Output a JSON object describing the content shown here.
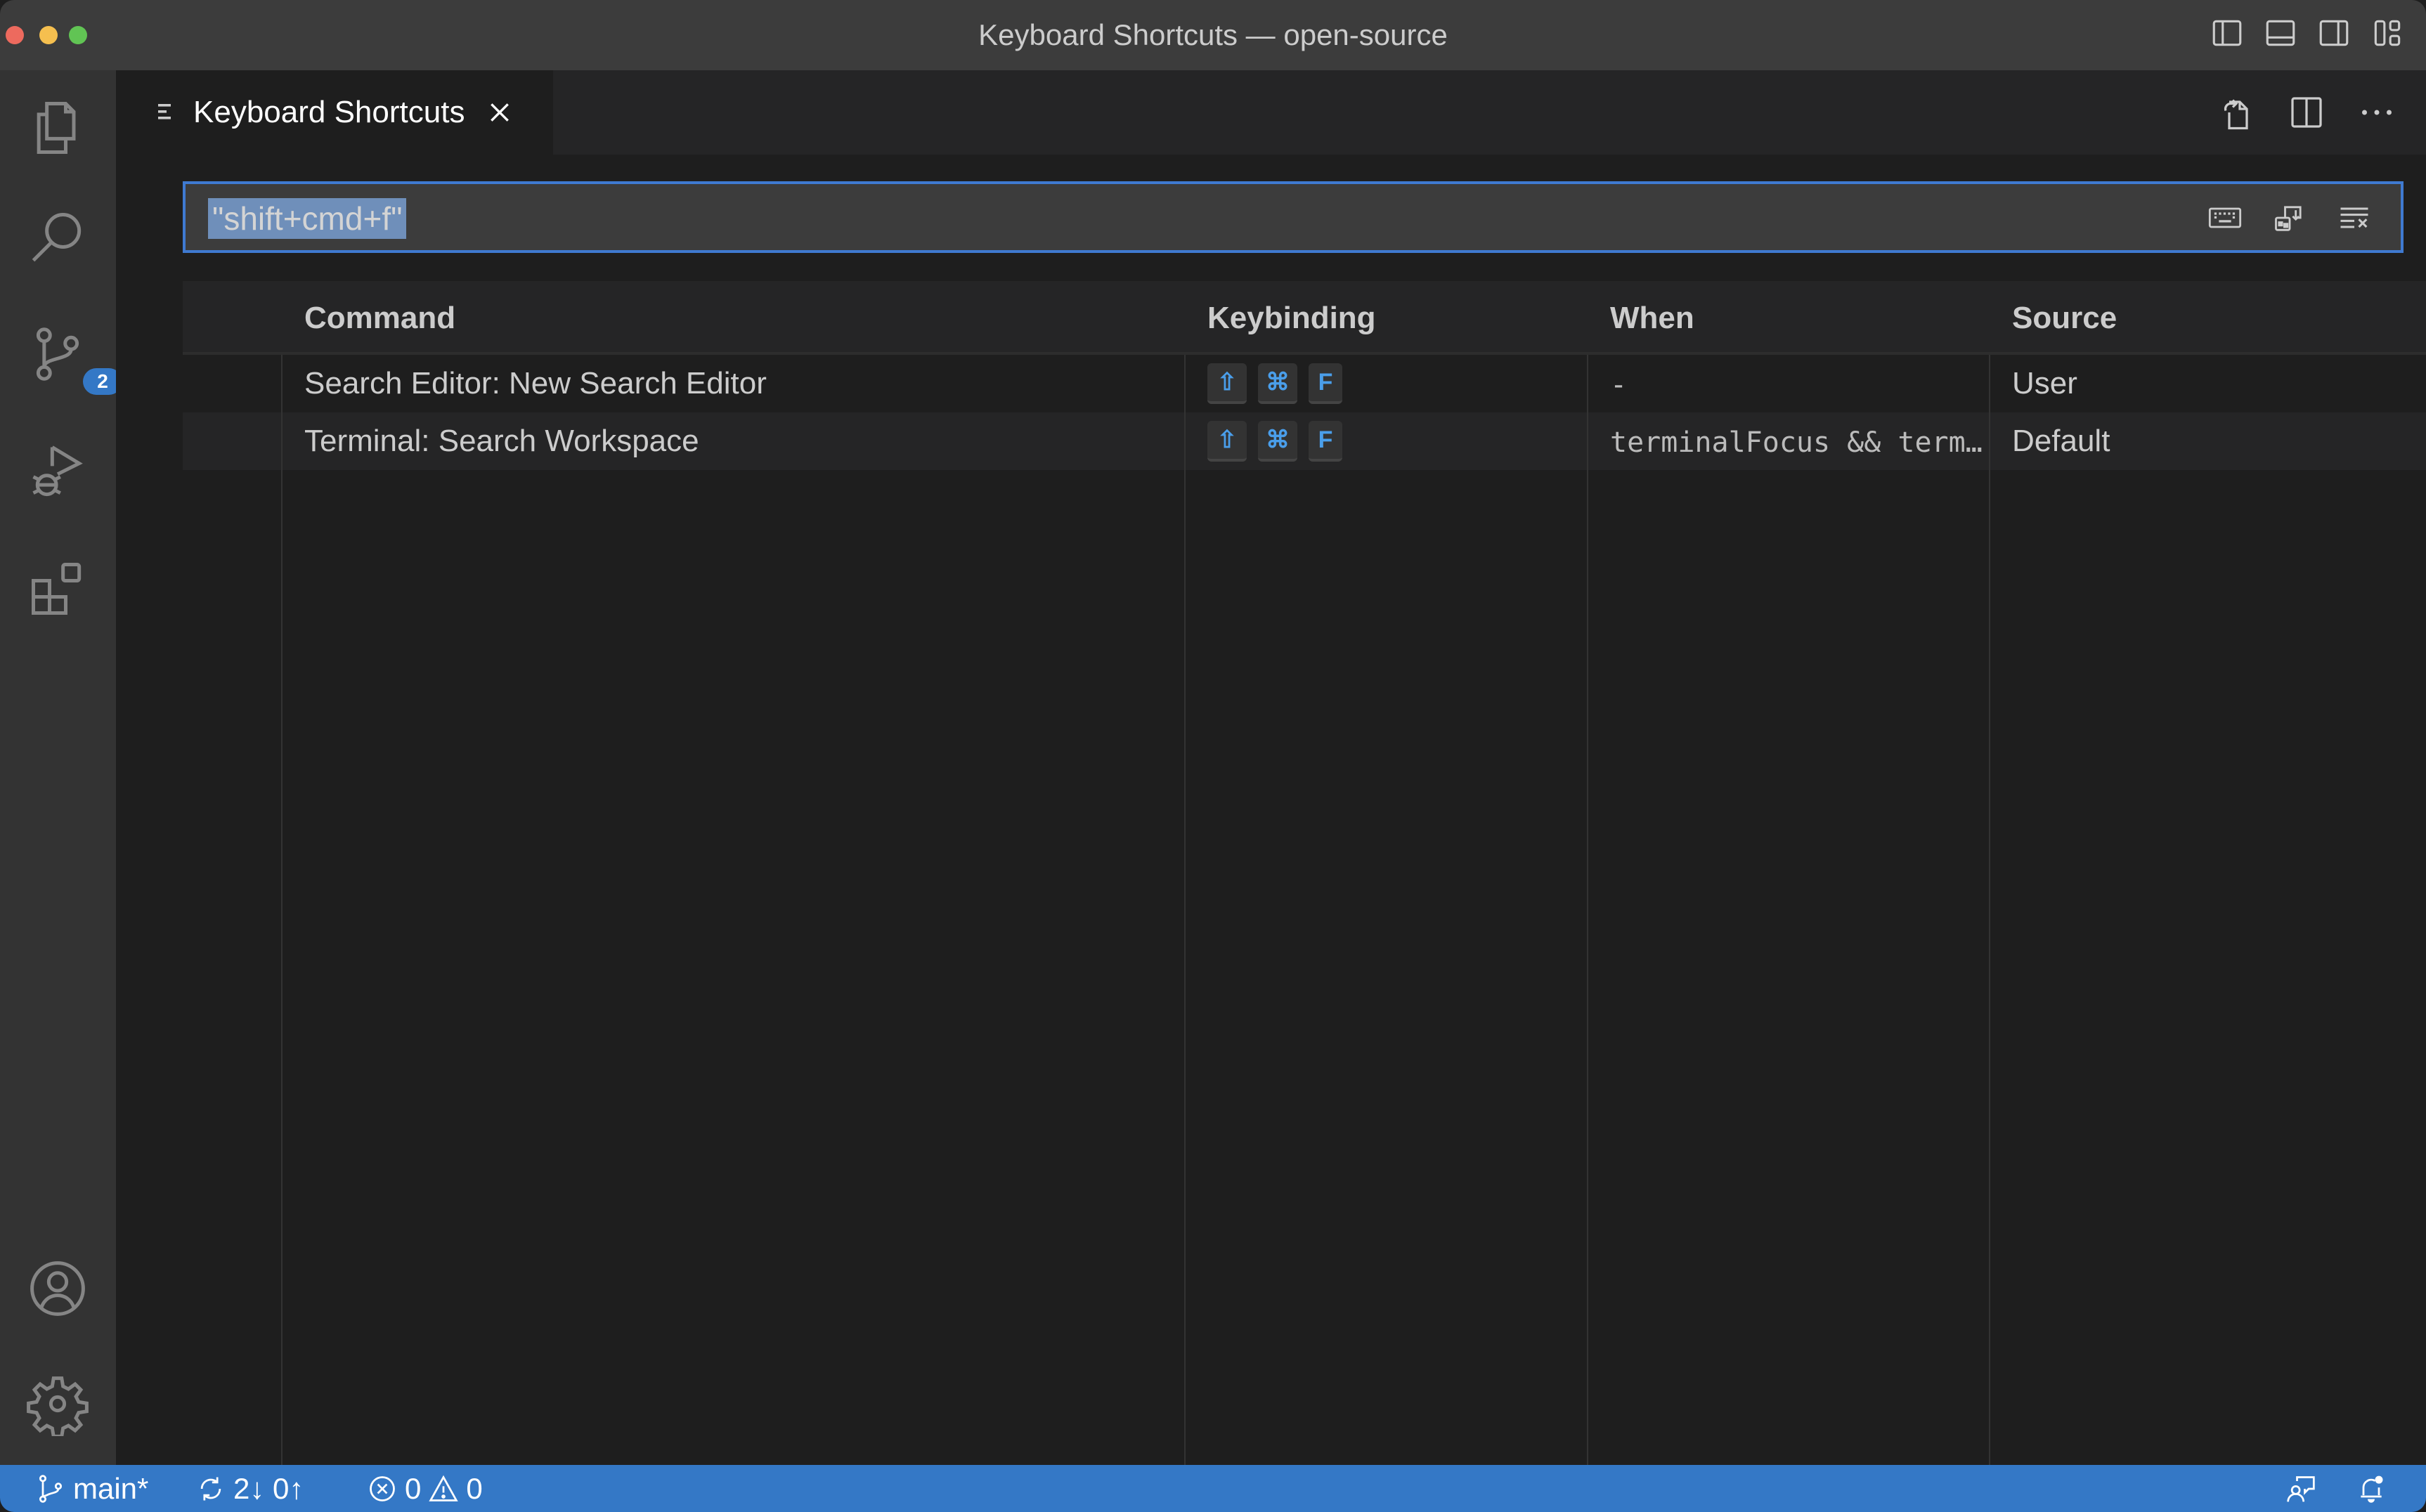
{
  "window": {
    "title": "Keyboard Shortcuts — open-source",
    "layout_icons": [
      "toggle-primary-sidebar-icon",
      "toggle-panel-icon",
      "toggle-secondary-sidebar-icon",
      "customize-layout-icon"
    ]
  },
  "activity_bar": {
    "items": [
      {
        "name": "explorer",
        "icon": "files-icon"
      },
      {
        "name": "search",
        "icon": "search-icon"
      },
      {
        "name": "source-control",
        "icon": "source-control-icon",
        "badge": "2"
      },
      {
        "name": "run-and-debug",
        "icon": "run-debug-icon"
      },
      {
        "name": "extensions",
        "icon": "extensions-icon"
      }
    ],
    "bottom_items": [
      {
        "name": "accounts",
        "icon": "account-icon"
      },
      {
        "name": "manage",
        "icon": "gear-icon"
      }
    ]
  },
  "tabs": [
    {
      "label": "Keyboard Shortcuts",
      "icon": "keyboard-shortcuts-icon",
      "active": true
    }
  ],
  "editor_actions": [
    "open-keyboard-shortcuts-json-icon",
    "split-editor-icon",
    "more-actions-icon"
  ],
  "search": {
    "value": "\"shift+cmd+f\"",
    "actions": [
      "record-keys-icon",
      "sort-by-precedence-icon",
      "clear-search-icon"
    ]
  },
  "table": {
    "headers": {
      "command": "Command",
      "keybinding": "Keybinding",
      "when": "When",
      "source": "Source"
    },
    "rows": [
      {
        "command": "Search Editor: New Search Editor",
        "keys": [
          "⇧",
          "⌘",
          "F"
        ],
        "when": "-",
        "source": "User"
      },
      {
        "command": "Terminal: Search Workspace",
        "keys": [
          "⇧",
          "⌘",
          "F"
        ],
        "when": "terminalFocus && term…",
        "source": "Default"
      }
    ]
  },
  "status_bar": {
    "branch": "main*",
    "sync": "2↓ 0↑",
    "errors": "0",
    "warnings": "0"
  },
  "colors": {
    "accent": "#3478c6",
    "focus_border": "#3f7ad1",
    "key_glyph": "#4a9eea"
  }
}
